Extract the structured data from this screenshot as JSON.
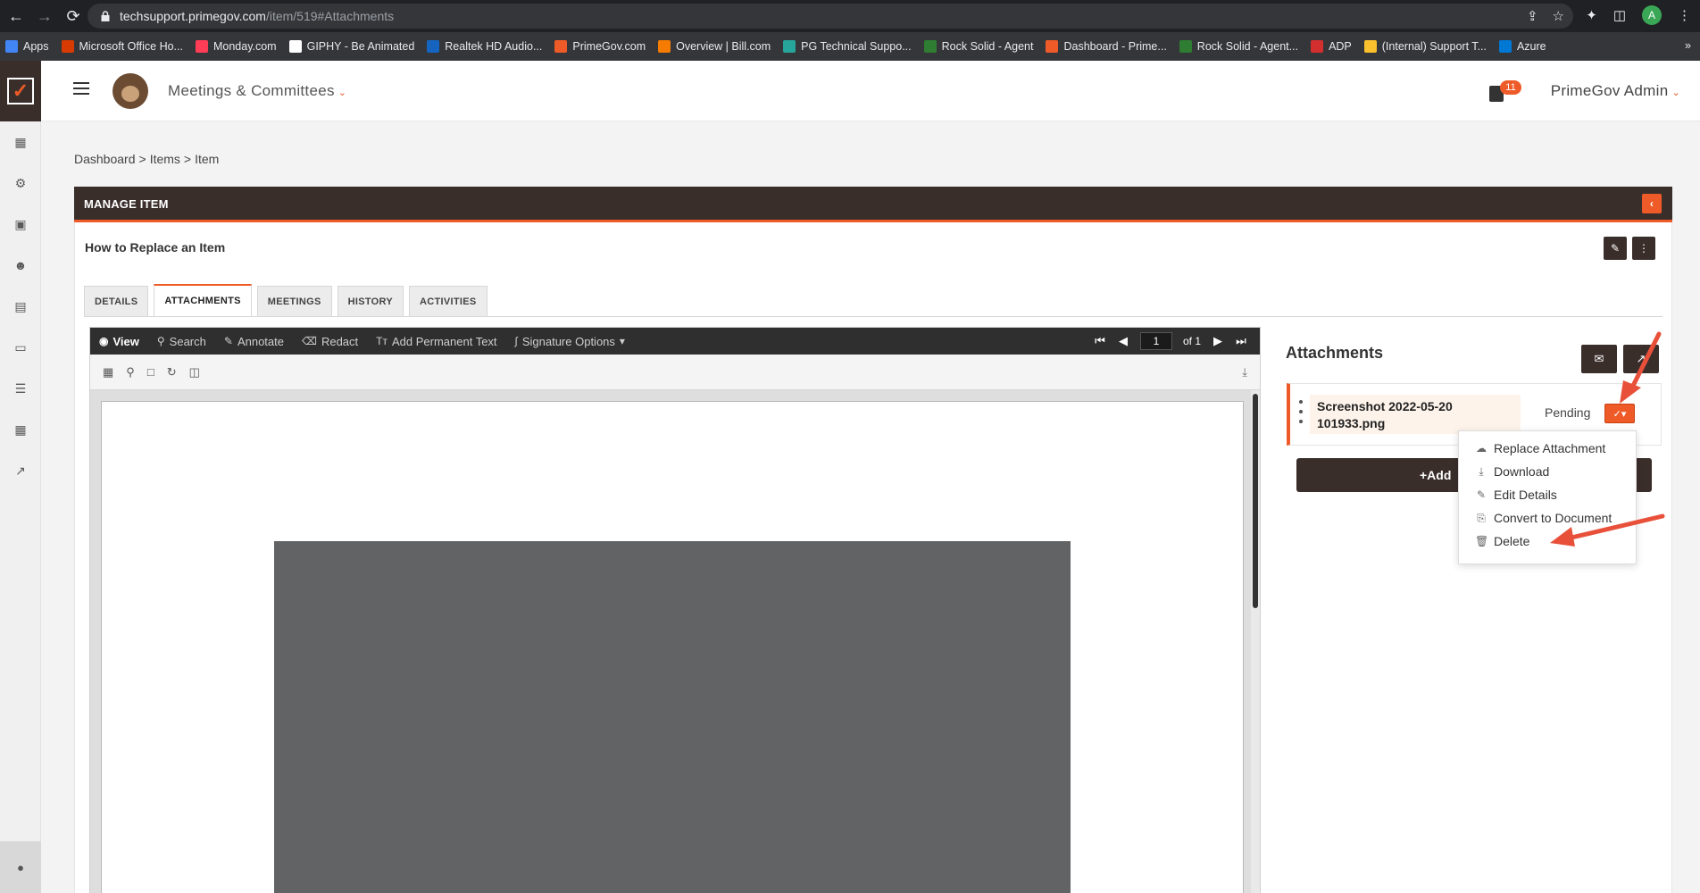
{
  "browser": {
    "url_host": "techsupport.primegov.com",
    "url_path": "/item/519#Attachments",
    "profile_initial": "A",
    "bookmarks": [
      {
        "label": "Apps",
        "color": "#4285f4"
      },
      {
        "label": "Microsoft Office Ho...",
        "color": "#d83b01"
      },
      {
        "label": "Monday.com",
        "color": "#ff3d57"
      },
      {
        "label": "GIPHY - Be Animated",
        "color": "#ffffff"
      },
      {
        "label": "Realtek HD Audio...",
        "color": "#1565c0"
      },
      {
        "label": "PrimeGov.com",
        "color": "#ee5b28"
      },
      {
        "label": "Overview | Bill.com",
        "color": "#f57c00"
      },
      {
        "label": "PG Technical Suppo...",
        "color": "#26a69a"
      },
      {
        "label": "Rock Solid - Agent",
        "color": "#2e7d32"
      },
      {
        "label": "Dashboard - Prime...",
        "color": "#ee5b28"
      },
      {
        "label": "Rock Solid - Agent...",
        "color": "#2e7d32"
      },
      {
        "label": "ADP",
        "color": "#d32f2f"
      },
      {
        "label": "(Internal) Support T...",
        "color": "#fbc02d"
      },
      {
        "label": "Azure",
        "color": "#0078d4"
      }
    ]
  },
  "header": {
    "module": "Meetings & Committees",
    "notification_count": "11",
    "user": "PrimeGov Admin"
  },
  "breadcrumb": [
    "Dashboard",
    ">",
    "Items",
    ">",
    "Item"
  ],
  "panel": {
    "title": "MANAGE ITEM",
    "item_title": "How to Replace an Item"
  },
  "tabs": [
    {
      "label": "DETAILS",
      "active": false
    },
    {
      "label": "ATTACHMENTS",
      "active": true
    },
    {
      "label": "MEETINGS",
      "active": false
    },
    {
      "label": "HISTORY",
      "active": false
    },
    {
      "label": "ACTIVITIES",
      "active": false
    }
  ],
  "viewer": {
    "tools": [
      "View",
      "Search",
      "Annotate",
      "Redact",
      "Add Permanent Text",
      "Signature Options"
    ],
    "page_current": "1",
    "page_total_label": "of 1"
  },
  "attachments": {
    "heading": "Attachments",
    "file_line1": "Screenshot 2022-05-20",
    "file_line2": "101933.png",
    "status": "Pending",
    "add_label": "+Add",
    "menu": [
      {
        "label": "Replace Attachment",
        "icon": "cloud-upload-icon"
      },
      {
        "label": "Download",
        "icon": "download-icon"
      },
      {
        "label": "Edit Details",
        "icon": "pencil-icon"
      },
      {
        "label": "Convert to Document",
        "icon": "convert-icon"
      },
      {
        "label": "Delete",
        "icon": "trash-icon"
      }
    ]
  },
  "colors": {
    "accent": "#ee5b28",
    "dark": "#3a2e2b",
    "annotation_arrow": "#e8503a"
  }
}
